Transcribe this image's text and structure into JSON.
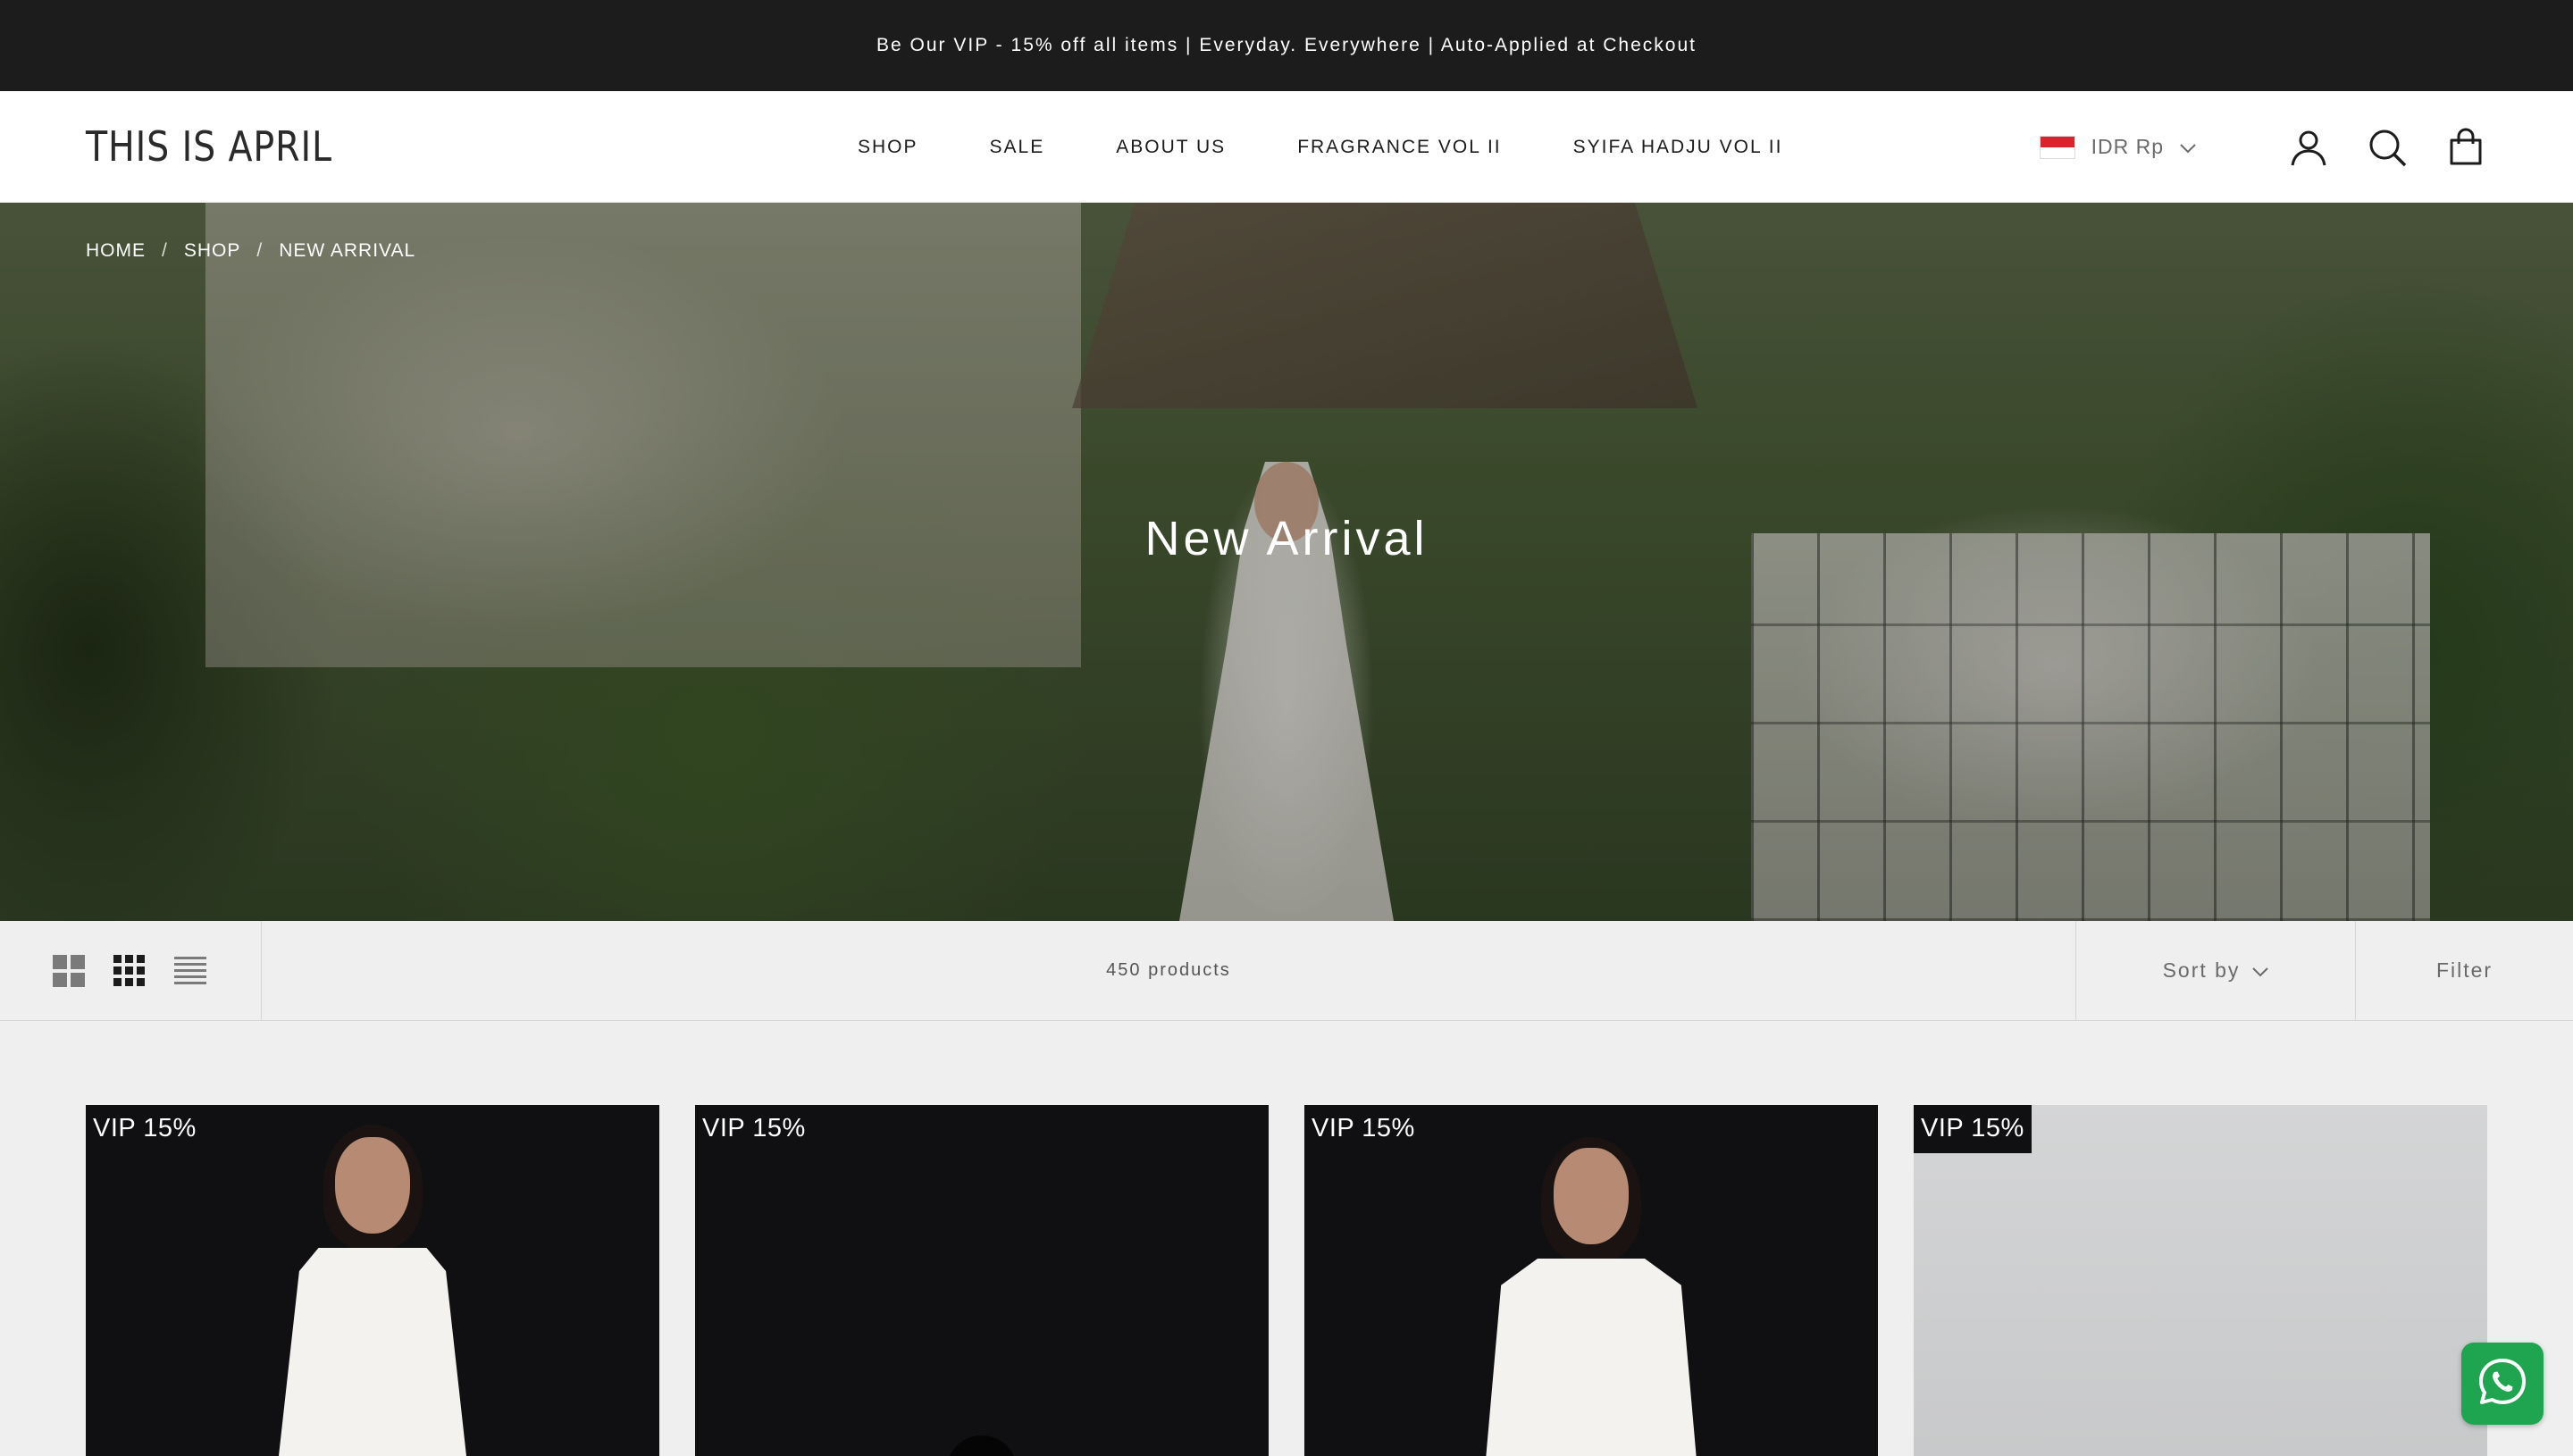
{
  "announcement": "Be Our VIP - 15% off all items | Everyday. Everywhere | Auto-Applied at Checkout",
  "header": {
    "logo": "THIS IS APRIL",
    "nav": [
      "SHOP",
      "SALE",
      "ABOUT US",
      "FRAGRANCE VOL II",
      "SYIFA HADJU VOL II"
    ],
    "currency": "IDR Rp",
    "icons": [
      "flag-indonesia-icon",
      "chevron-down-icon",
      "account-icon",
      "search-icon",
      "cart-bag-icon"
    ]
  },
  "hero": {
    "breadcrumb": [
      "HOME",
      "SHOP",
      "NEW ARRIVAL"
    ],
    "breadcrumb_sep": "/",
    "title": "New Arrival"
  },
  "toolbar": {
    "layout_icons": [
      "grid-large-icon",
      "grid-small-icon",
      "list-icon"
    ],
    "product_count": "450 products",
    "sort_label": "Sort by",
    "filter_label": "Filter"
  },
  "products": [
    {
      "badge": "VIP 15%"
    },
    {
      "badge": "VIP 15%"
    },
    {
      "badge": "VIP 15%"
    },
    {
      "badge": "VIP 15%"
    }
  ],
  "colors": {
    "announcement_bg": "#1c1c1c",
    "badge_bg": "#101012",
    "whatsapp": "#1fa450",
    "flag_red": "#d8242c"
  }
}
